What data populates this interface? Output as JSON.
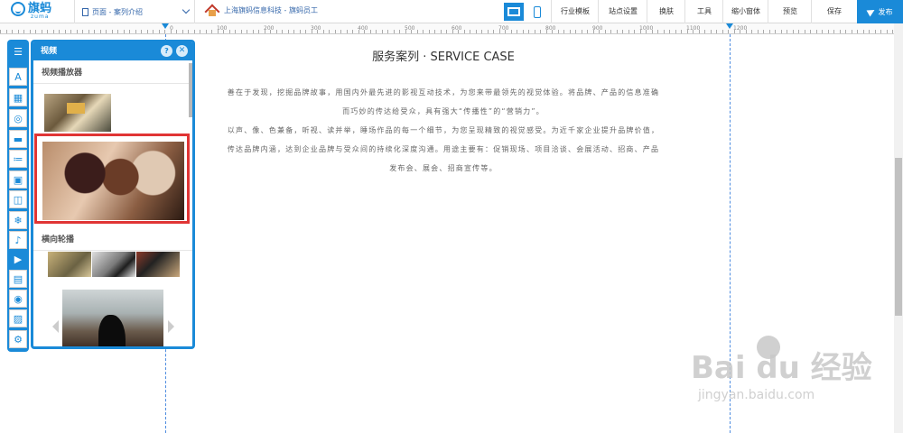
{
  "header": {
    "logo_name": "旗蚂",
    "logo_sub": "zuma",
    "page_select": "页面 - 案列介绍",
    "site_name": "上海旗蚂信息科技 - 旗蚂员工",
    "menu": [
      "行业模板",
      "站点设置",
      "换肤",
      "工具",
      "缩小窗体",
      "预览",
      "保存"
    ],
    "publish": "发布",
    "colors": {
      "accent": "#1a8ad8",
      "selection": "#e03535"
    }
  },
  "ruler": {
    "labels": [
      "0",
      "100",
      "200",
      "300",
      "400",
      "500",
      "600",
      "700",
      "800",
      "900",
      "1000",
      "1100",
      "1200"
    ]
  },
  "content": {
    "title": "服务案列 · SERVICE CASE",
    "lines": [
      "善在于发现，挖掘品牌故事，用国内外最先进的影视互动技术，为您来带最领先的视觉体验。将品牌、产品的信息准确",
      "而巧妙的传达给受众，具有强大“传播性”的“营销力”。",
      "以声、像、色兼备，听视、读并举，睡场作品的每一个细节，为您呈现精致的视觉感受。为近千家企业提升品牌价值，",
      "传达品牌内涵，达到企业品牌与受众间的持续化深度沟通。用途主要有：促销现场、项目洽谈、会展活动、招商、产品",
      "发布会、展会、招商宣传等。"
    ]
  },
  "panel": {
    "title": "视频",
    "help": "?",
    "close": "✕",
    "sections": [
      {
        "title": "视频播放器"
      },
      {
        "title": "横向轮播"
      }
    ]
  },
  "toolbar": {
    "icons": [
      "list-icon",
      "text-icon",
      "image-text-icon",
      "shapes-icon",
      "divider-icon",
      "list-bullets-icon",
      "gallery-icon",
      "shopping-bag-icon",
      "snowflake-icon",
      "music-icon",
      "video-icon",
      "form-icon",
      "circle-icon",
      "picture-icon",
      "search-gear-icon"
    ],
    "glyphs": [
      "☰",
      "A",
      "▦",
      "◎",
      "▬",
      "≔",
      "▣",
      "◫",
      "❄",
      "♪",
      "▶",
      "▤",
      "◉",
      "▨",
      "⚙"
    ]
  },
  "watermark": {
    "brand": "Bai du 经验",
    "url": "jingyan.baidu.com"
  }
}
